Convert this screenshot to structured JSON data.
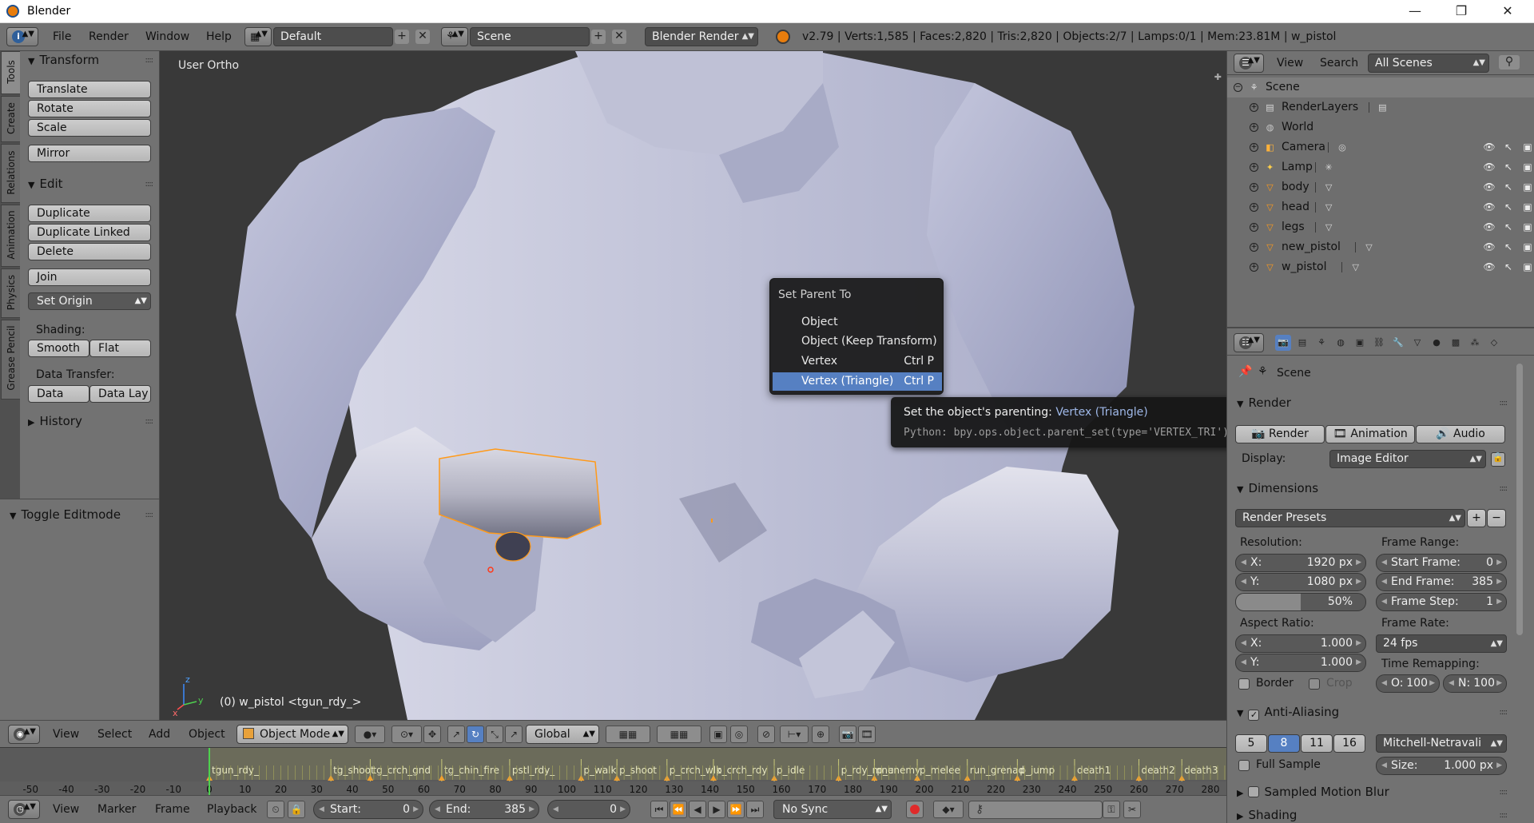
{
  "window": {
    "title": "Blender",
    "minimize": "—",
    "maximize": "❐",
    "close": "✕"
  },
  "info_header": {
    "menus": [
      "File",
      "Render",
      "Window",
      "Help"
    ],
    "layout": "Default",
    "scene": "Scene",
    "engine": "Blender Render",
    "stats": "v2.79 | Verts:1,585 | Faces:2,820 | Tris:2,820 | Objects:2/7 | Lamps:0/1 | Mem:23.81M | w_pistol"
  },
  "tool_tabs": [
    "Tools",
    "Create",
    "Relations",
    "Animation",
    "Physics",
    "Grease Pencil"
  ],
  "tool_shelf": {
    "transform": {
      "title": "Transform",
      "buttons": [
        "Translate",
        "Rotate",
        "Scale",
        "Mirror"
      ]
    },
    "edit": {
      "title": "Edit",
      "buttons": [
        "Duplicate",
        "Duplicate Linked",
        "Delete",
        "Join"
      ],
      "set_origin": "Set Origin",
      "shading_label": "Shading:",
      "smooth": "Smooth",
      "flat": "Flat",
      "data_transfer_label": "Data Transfer:",
      "data": "Data",
      "data_lay": "Data Lay"
    },
    "history": "History"
  },
  "operator_panel": {
    "title": "Toggle Editmode"
  },
  "viewport": {
    "view_label": "User Ortho",
    "object_label": "(0) w_pistol <tgun_rdy_>",
    "axes": {
      "x": "x",
      "y": "y",
      "z": "z"
    }
  },
  "context_menu": {
    "title": "Set Parent To",
    "items": [
      {
        "label": "Object",
        "shortcut": ""
      },
      {
        "label": "Object (Keep Transform)",
        "shortcut": ""
      },
      {
        "label": "Vertex",
        "shortcut": "Ctrl P"
      },
      {
        "label": "Vertex (Triangle)",
        "shortcut": "Ctrl P"
      }
    ]
  },
  "tooltip": {
    "text": "Set the object's parenting:",
    "value": "Vertex (Triangle)",
    "python": "Python: bpy.ops.object.parent_set(type='VERTEX_TRI')"
  },
  "view_header": {
    "menus": [
      "View",
      "Select",
      "Add",
      "Object"
    ],
    "mode": "Object Mode",
    "orientation": "Global"
  },
  "timeline": {
    "ruler": [
      "-50",
      "-40",
      "-30",
      "-20",
      "-10",
      "0",
      "10",
      "20",
      "30",
      "40",
      "50",
      "60",
      "70",
      "80",
      "90",
      "100",
      "110",
      "120",
      "130",
      "140",
      "150",
      "160",
      "170",
      "180",
      "190",
      "200",
      "210",
      "220",
      "230",
      "240",
      "250",
      "260",
      "270",
      "280"
    ],
    "markers": [
      {
        "label": "tgun_rdy_",
        "frame": 0
      },
      {
        "label": "tg_shoot",
        "frame": 34
      },
      {
        "label": "tg_crch_gnd",
        "frame": 45
      },
      {
        "label": "tg_chin_fire",
        "frame": 65
      },
      {
        "label": "pstl_rdy_",
        "frame": 84
      },
      {
        "label": "p_walk",
        "frame": 104
      },
      {
        "label": "p_shoot",
        "frame": 114
      },
      {
        "label": "p_crch_wlk",
        "frame": 128
      },
      {
        "label": "p_crch_rdy",
        "frame": 141
      },
      {
        "label": "p_idle",
        "frame": 158
      },
      {
        "label": "p_rdy_mnu",
        "frame": 176
      },
      {
        "label": "p_enemy",
        "frame": 186
      },
      {
        "label": "p_melee",
        "frame": 198
      },
      {
        "label": "run_grenad",
        "frame": 212
      },
      {
        "label": "p_jump",
        "frame": 226
      },
      {
        "label": "death1",
        "frame": 242
      },
      {
        "label": "death2",
        "frame": 260
      },
      {
        "label": "death3",
        "frame": 272
      }
    ]
  },
  "timeline_header": {
    "menus": [
      "View",
      "Marker",
      "Frame",
      "Playback"
    ],
    "start_label": "Start:",
    "start": "0",
    "end_label": "End:",
    "end": "385",
    "current": "0",
    "sync": "No Sync"
  },
  "outliner": {
    "menus": [
      "View",
      "Search"
    ],
    "filter": "All Scenes",
    "rows": [
      {
        "name": "Scene",
        "icon": "scene-icon",
        "depth": 0
      },
      {
        "name": "RenderLayers",
        "icon": "render-layers-icon",
        "depth": 1
      },
      {
        "name": "World",
        "icon": "world-icon",
        "depth": 1
      },
      {
        "name": "Camera",
        "icon": "camera-icon",
        "depth": 1
      },
      {
        "name": "Lamp",
        "icon": "lamp-icon",
        "depth": 1
      },
      {
        "name": "body",
        "icon": "mesh-icon",
        "depth": 1
      },
      {
        "name": "head",
        "icon": "mesh-icon",
        "depth": 1
      },
      {
        "name": "legs",
        "icon": "mesh-icon",
        "depth": 1
      },
      {
        "name": "new_pistol",
        "icon": "mesh-icon",
        "depth": 1
      },
      {
        "name": "w_pistol",
        "icon": "mesh-icon",
        "depth": 1
      }
    ]
  },
  "properties": {
    "context": "Scene",
    "render": {
      "title": "Render",
      "render_btn": "Render",
      "animation_btn": "Animation",
      "audio_btn": "Audio",
      "display_label": "Display:",
      "display": "Image Editor"
    },
    "dimensions": {
      "title": "Dimensions",
      "presets": "Render Presets",
      "resolution_label": "Resolution:",
      "res_x_label": "X:",
      "res_x": "1920 px",
      "res_y_label": "Y:",
      "res_y": "1080 px",
      "res_pct": "50%",
      "frame_range_label": "Frame Range:",
      "start_frame_label": "Start Frame:",
      "start_frame": "0",
      "end_frame_label": "End Frame:",
      "end_frame": "385",
      "frame_step_label": "Frame Step:",
      "frame_step": "1",
      "aspect_label": "Aspect Ratio:",
      "asp_x_label": "X:",
      "asp_x": "1.000",
      "asp_y_label": "Y:",
      "asp_y": "1.000",
      "frame_rate_label": "Frame Rate:",
      "frame_rate": "24 fps",
      "time_remap_label": "Time Remapping:",
      "old_label": "O:",
      "old": "100",
      "new_label": "N:",
      "new": "100",
      "border": "Border",
      "crop": "Crop"
    },
    "anti_aliasing": {
      "title": "Anti-Aliasing",
      "samples": [
        "5",
        "8",
        "11",
        "16"
      ],
      "filter": "Mitchell-Netravali",
      "full_sample": "Full Sample",
      "size_label": "Size:",
      "size": "1.000 px"
    },
    "sampled_motion_blur": "Sampled Motion Blur",
    "shading": "Shading"
  },
  "colors": {
    "accent": "#5680c2",
    "selection_outline": "#ff9a1a",
    "panel": "#727272",
    "viewport_bg": "#393939"
  }
}
